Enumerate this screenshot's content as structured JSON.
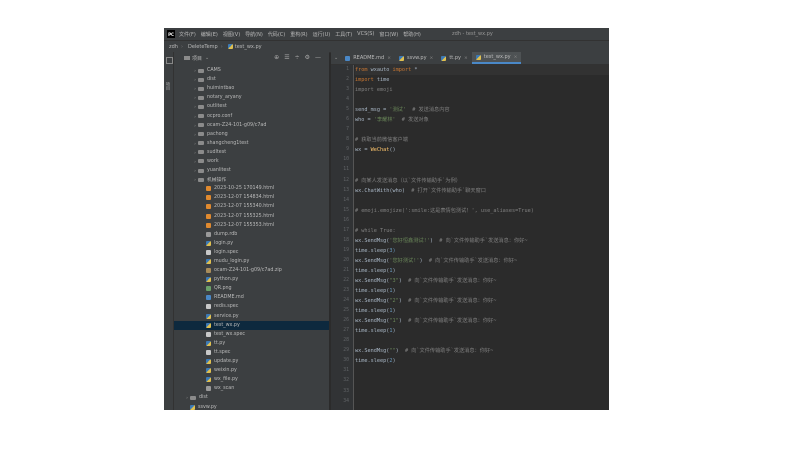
{
  "menubar": {
    "items": [
      "文件(F)",
      "编辑(E)",
      "视图(V)",
      "导航(N)",
      "代码(C)",
      "重构(R)",
      "运行(U)",
      "工具(T)",
      "VCS(S)",
      "窗口(W)",
      "帮助(H)"
    ],
    "window_title": "zdh - test_wx.py"
  },
  "breadcrumb": {
    "project": "zdh",
    "folder": "DeleteTemp",
    "file": "test_wx.py"
  },
  "left_strip": {
    "label": "项目"
  },
  "project_panel": {
    "title": "项目",
    "tools": [
      "⊕",
      "☰",
      "÷",
      "⚙",
      "—"
    ],
    "tree": [
      {
        "label": "CAMS",
        "type": "folder",
        "indent": 1,
        "arrow": "›"
      },
      {
        "label": "dist",
        "type": "folder",
        "indent": 1,
        "arrow": "›"
      },
      {
        "label": "huimintbao",
        "type": "folder",
        "indent": 1,
        "arrow": "›"
      },
      {
        "label": "notary_aryany",
        "type": "folder",
        "indent": 1,
        "arrow": "›"
      },
      {
        "label": "outlitest",
        "type": "folder",
        "indent": 1,
        "arrow": "›"
      },
      {
        "label": "ocpro.conf",
        "type": "folder",
        "indent": 1,
        "arrow": "›"
      },
      {
        "label": "ocam-Z24-101-g09/c7ad",
        "type": "folder",
        "indent": 1,
        "arrow": "›"
      },
      {
        "label": "pachong",
        "type": "folder",
        "indent": 1,
        "arrow": "›"
      },
      {
        "label": "shangcheng1test",
        "type": "folder",
        "indent": 1,
        "arrow": "›"
      },
      {
        "label": "sudltest",
        "type": "folder",
        "indent": 1,
        "arrow": "›"
      },
      {
        "label": "work",
        "type": "folder",
        "indent": 1,
        "arrow": "›"
      },
      {
        "label": "yuanlitest",
        "type": "folder",
        "indent": 1,
        "arrow": "›"
      },
      {
        "label": "机械操作",
        "type": "folder",
        "indent": 1,
        "arrow": "›"
      },
      {
        "label": "2023-10-25 170149.html",
        "type": "html",
        "indent": 2,
        "arrow": ""
      },
      {
        "label": "2023-12-07 154834.html",
        "type": "html",
        "indent": 2,
        "arrow": ""
      },
      {
        "label": "2023-12-07 155340.html",
        "type": "html",
        "indent": 2,
        "arrow": ""
      },
      {
        "label": "2023-12-07 155325.html",
        "type": "html",
        "indent": 2,
        "arrow": ""
      },
      {
        "label": "2023-12-07 155353.html",
        "type": "html",
        "indent": 2,
        "arrow": ""
      },
      {
        "label": "dump.rdb",
        "type": "file",
        "indent": 2,
        "arrow": ""
      },
      {
        "label": "login.py",
        "type": "py",
        "indent": 2,
        "arrow": ""
      },
      {
        "label": "login.spec",
        "type": "spec",
        "indent": 2,
        "arrow": ""
      },
      {
        "label": "mudu_login.py",
        "type": "py",
        "indent": 2,
        "arrow": ""
      },
      {
        "label": "ocam-Z24-101-g09/c7ad.zip",
        "type": "zip",
        "indent": 2,
        "arrow": ""
      },
      {
        "label": "python.py",
        "type": "py",
        "indent": 2,
        "arrow": ""
      },
      {
        "label": "QR.png",
        "type": "img",
        "indent": 2,
        "arrow": ""
      },
      {
        "label": "README.md",
        "type": "md",
        "indent": 2,
        "arrow": ""
      },
      {
        "label": "redis.spec",
        "type": "spec",
        "indent": 2,
        "arrow": ""
      },
      {
        "label": "service.py",
        "type": "py",
        "indent": 2,
        "arrow": ""
      },
      {
        "label": "test_wx.py",
        "type": "py",
        "indent": 2,
        "arrow": "",
        "selected": true
      },
      {
        "label": "test_wx.spec",
        "type": "spec",
        "indent": 2,
        "arrow": ""
      },
      {
        "label": "tt.py",
        "type": "py",
        "indent": 2,
        "arrow": ""
      },
      {
        "label": "tt.spec",
        "type": "spec",
        "indent": 2,
        "arrow": ""
      },
      {
        "label": "update.py",
        "type": "py",
        "indent": 2,
        "arrow": ""
      },
      {
        "label": "weixin.py",
        "type": "py",
        "indent": 2,
        "arrow": ""
      },
      {
        "label": "wx_file.py",
        "type": "py",
        "indent": 2,
        "arrow": ""
      },
      {
        "label": "wx_scan",
        "type": "file",
        "indent": 2,
        "arrow": ""
      },
      {
        "label": "dist",
        "type": "folder",
        "indent": 0,
        "arrow": "›"
      },
      {
        "label": "ssvw.py",
        "type": "py",
        "indent": 0,
        "arrow": ""
      }
    ]
  },
  "tabs": [
    {
      "label": "README.md",
      "icon": "md",
      "active": false
    },
    {
      "label": "ssvw.py",
      "icon": "py",
      "active": false
    },
    {
      "label": "tt.py",
      "icon": "py",
      "active": false
    },
    {
      "label": "test_wx.py",
      "icon": "py",
      "active": true
    }
  ],
  "editor": {
    "lines": [
      [
        {
          "t": "from",
          "c": "kw"
        },
        {
          "t": " wxauto ",
          "c": ""
        },
        {
          "t": "import",
          "c": "kw"
        },
        {
          "t": " *",
          "c": ""
        }
      ],
      [
        {
          "t": "import",
          "c": "kw"
        },
        {
          "t": " time",
          "c": ""
        }
      ],
      [
        {
          "t": "import emoji",
          "c": "dim"
        }
      ],
      [],
      [
        {
          "t": "send_msg = ",
          "c": ""
        },
        {
          "t": "'测试'",
          "c": "str"
        },
        {
          "t": "  # 发送消息内容",
          "c": "com"
        }
      ],
      [
        {
          "t": "who = ",
          "c": ""
        },
        {
          "t": "'李耀林'",
          "c": "str"
        },
        {
          "t": "  # 发送对象",
          "c": "com"
        }
      ],
      [],
      [
        {
          "t": "# 获取当前微信客户端",
          "c": "com"
        }
      ],
      [
        {
          "t": "wx = ",
          "c": ""
        },
        {
          "t": "WeChat",
          "c": "fn"
        },
        {
          "t": "()",
          "c": ""
        }
      ],
      [],
      [],
      [
        {
          "t": "# 向某人发送消息（以`文件传输助手`为例）",
          "c": "com"
        }
      ],
      [
        {
          "t": "wx.ChatWith(who)  ",
          "c": ""
        },
        {
          "t": "# 打开`文件传输助手`聊天窗口",
          "c": "com"
        }
      ],
      [],
      [
        {
          "t": "# emoji.emojize(':smile:这是表情包测试！', use_aliases=True)",
          "c": "com"
        }
      ],
      [],
      [
        {
          "t": "# while True:",
          "c": "com"
        }
      ],
      [
        {
          "t": "wx.SendMsg(",
          "c": ""
        },
        {
          "t": "'您好恒鑫测试!'",
          "c": "str"
        },
        {
          "t": ")  ",
          "c": ""
        },
        {
          "t": "# 向`文件传输助手`发送消息：你好~",
          "c": "com"
        }
      ],
      [
        {
          "t": "time.sleep(",
          "c": ""
        },
        {
          "t": "3",
          "c": "num"
        },
        {
          "t": ")",
          "c": "num"
        }
      ],
      [
        {
          "t": "wx.SendMsg(",
          "c": ""
        },
        {
          "t": "'您好测试!'",
          "c": "str"
        },
        {
          "t": ")  ",
          "c": ""
        },
        {
          "t": "# 向`文件传输助手`发送消息：你好~",
          "c": "com"
        }
      ],
      [
        {
          "t": "time.sleep(",
          "c": ""
        },
        {
          "t": "1",
          "c": "num"
        },
        {
          "t": ")",
          "c": ""
        }
      ],
      [
        {
          "t": "wx.SendMsg(",
          "c": ""
        },
        {
          "t": "\"3\"",
          "c": "str"
        },
        {
          "t": ")  ",
          "c": ""
        },
        {
          "t": "# 向`文件传输助手`发送消息：你好~",
          "c": "com"
        }
      ],
      [
        {
          "t": "time.sleep(",
          "c": ""
        },
        {
          "t": "1",
          "c": "num"
        },
        {
          "t": ")",
          "c": ""
        }
      ],
      [
        {
          "t": "wx.SendMsg(",
          "c": ""
        },
        {
          "t": "\"2\"",
          "c": "str"
        },
        {
          "t": ")  ",
          "c": ""
        },
        {
          "t": "# 向`文件传输助手`发送消息：你好~",
          "c": "com"
        }
      ],
      [
        {
          "t": "time.sleep(",
          "c": ""
        },
        {
          "t": "1",
          "c": "num"
        },
        {
          "t": ")",
          "c": ""
        }
      ],
      [
        {
          "t": "wx.SendMsg(",
          "c": ""
        },
        {
          "t": "\"1\"",
          "c": "str"
        },
        {
          "t": ")  ",
          "c": ""
        },
        {
          "t": "# 向`文件传输助手`发送消息：你好~",
          "c": "com"
        }
      ],
      [
        {
          "t": "time.sleep(",
          "c": ""
        },
        {
          "t": "1",
          "c": "num"
        },
        {
          "t": ")",
          "c": ""
        }
      ],
      [],
      [
        {
          "t": "wx.SendMsg(",
          "c": ""
        },
        {
          "t": "\"\"",
          "c": "str"
        },
        {
          "t": ")  ",
          "c": ""
        },
        {
          "t": "# 向`文件传输助手`发送消息：你好~",
          "c": "com"
        }
      ],
      [
        {
          "t": "time.sleep(",
          "c": ""
        },
        {
          "t": "2",
          "c": "num"
        },
        {
          "t": ")",
          "c": ""
        }
      ],
      [],
      [],
      [],
      []
    ]
  },
  "colors": {
    "accent": "#4a88c7",
    "background": "#2b2b2b",
    "panel": "#3c3f41"
  }
}
